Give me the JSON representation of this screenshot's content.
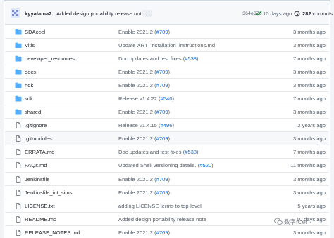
{
  "latest_commit": {
    "author": "kyyalama2",
    "message": "Added design portability release note",
    "ellipsis": "…",
    "sha": "364e373",
    "age": "10 days ago",
    "commit_count": "282",
    "commits_label": "commits"
  },
  "files": [
    {
      "type": "folder",
      "name": "SDAccel",
      "message": "Enable 2021.2 (#709)",
      "message_text": "Enable 2021.2 (",
      "pr": "#709",
      "message_suffix": ")",
      "age": "3 months ago"
    },
    {
      "type": "folder",
      "name": "Vitis",
      "message": "Update XRT_installation_instructions.md",
      "message_text": "Update XRT_installation_instructions.md",
      "pr": "",
      "message_suffix": "",
      "age": "3 months ago"
    },
    {
      "type": "folder",
      "name": "developer_resources",
      "message": "Doc updates and test fixes (#538)",
      "message_text": "Doc updates and test fixes (",
      "pr": "#538",
      "message_suffix": ")",
      "age": "7 months ago"
    },
    {
      "type": "folder",
      "name": "docs",
      "message": "Enable 2021.2 (#709)",
      "message_text": "Enable 2021.2 (",
      "pr": "#709",
      "message_suffix": ")",
      "age": "3 months ago"
    },
    {
      "type": "folder",
      "name": "hdk",
      "message": "Enable 2021.2 (#709)",
      "message_text": "Enable 2021.2 (",
      "pr": "#709",
      "message_suffix": ")",
      "age": "3 months ago"
    },
    {
      "type": "folder",
      "name": "sdk",
      "message": "Release v1.4.22 (#540)",
      "message_text": "Release v1.4.22 (",
      "pr": "#540",
      "message_suffix": ")",
      "age": "7 months ago"
    },
    {
      "type": "folder",
      "name": "shared",
      "message": "Enable 2021.2 (#709)",
      "message_text": "Enable 2021.2 (",
      "pr": "#709",
      "message_suffix": ")",
      "age": "3 months ago"
    },
    {
      "type": "file",
      "name": ".gitignore",
      "message": "Release v1.4.15 (#496)",
      "message_text": "Release v1.4.15 (",
      "pr": "#496",
      "message_suffix": ")",
      "age": "2 years ago"
    },
    {
      "type": "file",
      "name": ".gitmodules",
      "message": "Enable 2021.2 (#709)",
      "message_text": "Enable 2021.2 (",
      "pr": "#709",
      "message_suffix": ")",
      "age": "3 months ago"
    },
    {
      "type": "file",
      "name": "ERRATA.md",
      "message": "Doc updates and test fixes (#538)",
      "message_text": "Doc updates and test fixes (",
      "pr": "#538",
      "message_suffix": ")",
      "age": "7 months ago"
    },
    {
      "type": "file",
      "name": "FAQs.md",
      "message": "Updated Shell versioning details. (#520)",
      "message_text": "Updated Shell versioning details. (",
      "pr": "#520",
      "message_suffix": ")",
      "age": "11 months ago"
    },
    {
      "type": "file",
      "name": "Jenkinsfile",
      "message": "Enable 2021.2 (#709)",
      "message_text": "Enable 2021.2 (",
      "pr": "#709",
      "message_suffix": ")",
      "age": "3 months ago"
    },
    {
      "type": "file",
      "name": "Jenkinsfile_int_sims",
      "message": "Enable 2021.2 (#709)",
      "message_text": "Enable 2021.2 (",
      "pr": "#709",
      "message_suffix": ")",
      "age": "3 months ago"
    },
    {
      "type": "file",
      "name": "LICENSE.txt",
      "message": "adding LICENSE terms to top-level",
      "message_text": "adding LICENSE terms to top-level",
      "pr": "",
      "message_suffix": "",
      "age": "5 years ago"
    },
    {
      "type": "file",
      "name": "README.md",
      "message": "Added design portability release note",
      "message_text": "Added design portability release note",
      "pr": "",
      "message_suffix": "",
      "age": "10 days ago"
    },
    {
      "type": "file",
      "name": "RELEASE_NOTES.md",
      "message": "Enable 2021.2 (#709)",
      "message_text": "Enable 2021.2 (",
      "pr": "#709",
      "message_suffix": ")",
      "age": "3 months ago"
    }
  ],
  "watermark": {
    "text": "数字ICer"
  },
  "colors": {
    "folder": "#54aeff",
    "link": "#0969da",
    "muted": "#57606a",
    "success": "#1a7f37"
  }
}
